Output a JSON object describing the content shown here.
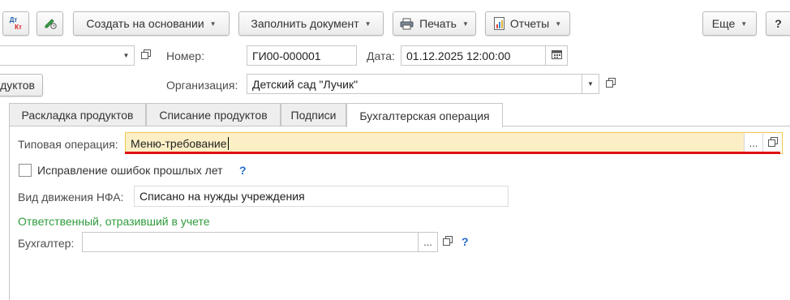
{
  "toolbar": {
    "dtkt_top": "Дт",
    "dtkt_bottom": "Кт",
    "create_based_label": "Создать на основании",
    "fill_doc_label": "Заполнить документ",
    "print_label": "Печать",
    "reports_label": "Отчеты",
    "more_label": "Еще",
    "help_label": "?"
  },
  "header": {
    "number_label": "Номер:",
    "number_value": "ГИ00-000001",
    "date_label": "Дата:",
    "date_value": "01.12.2025 12:00:00",
    "products_button_partial": "дуктов",
    "organization_label": "Организация:",
    "organization_value": "Детский сад \"Лучик\""
  },
  "tabs": [
    {
      "label": "Раскладка продуктов"
    },
    {
      "label": "Списание продуктов"
    },
    {
      "label": "Подписи"
    },
    {
      "label": "Бухгалтерская операция"
    }
  ],
  "form": {
    "typical_op_label": "Типовая операция:",
    "typical_op_value": "Меню-требование",
    "fix_errors_label": "Исправление ошибок прошлых лет",
    "fix_errors_checked": false,
    "help_mark": "?",
    "nfa_label": "Вид движения НФА:",
    "nfa_value": "Списано на нужды учреждения",
    "responsible_heading": "Ответственный, отразивший в учете",
    "accountant_label": "Бухгалтер:",
    "accountant_value": "",
    "ellipsis": "..."
  },
  "colors": {
    "accent_green": "#2e9b3c",
    "help_blue": "#2469c9",
    "highlight_fill": "#fcefc6",
    "highlight_border": "#f2c94c",
    "underline_red": "#e01010"
  }
}
